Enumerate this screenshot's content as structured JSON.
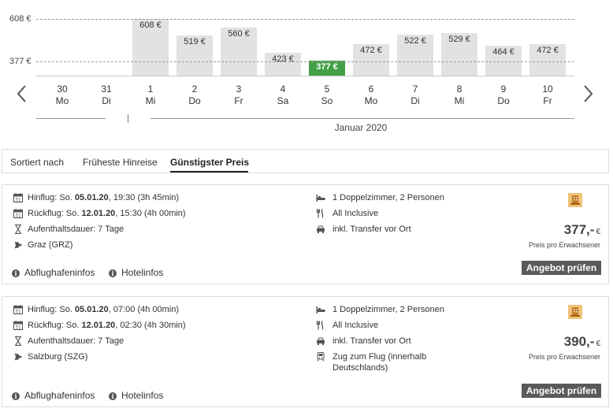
{
  "chart_data": {
    "type": "bar",
    "categories": [
      "1 Mi",
      "2 Do",
      "3 Fr",
      "4 Sa",
      "5 So",
      "6 Mo",
      "7 Di",
      "8 Mi",
      "9 Do",
      "10 Fr"
    ],
    "values": [
      608,
      519,
      560,
      423,
      377,
      472,
      522,
      529,
      464,
      472
    ],
    "labels": [
      "608 €",
      "519 €",
      "560 €",
      "423 €",
      "377 €",
      "472 €",
      "522 €",
      "529 €",
      "464 €",
      "472 €"
    ],
    "highlighted_index": 4,
    "ylim": [
      300,
      608
    ],
    "reference_lines": [
      {
        "value": 608,
        "label": "608 €"
      },
      {
        "value": 377,
        "label": "377 €"
      }
    ],
    "colors": {
      "bar": "#e2e2e2",
      "selected": "#43a047"
    }
  },
  "days": [
    {
      "num": "30",
      "dow": "Mo"
    },
    {
      "num": "31",
      "dow": "Di"
    },
    {
      "num": "1",
      "dow": "Mi"
    },
    {
      "num": "2",
      "dow": "Do"
    },
    {
      "num": "3",
      "dow": "Fr"
    },
    {
      "num": "4",
      "dow": "Sa"
    },
    {
      "num": "5",
      "dow": "So"
    },
    {
      "num": "6",
      "dow": "Mo"
    },
    {
      "num": "7",
      "dow": "Di"
    },
    {
      "num": "8",
      "dow": "Mi"
    },
    {
      "num": "9",
      "dow": "Do"
    },
    {
      "num": "10",
      "dow": "Fr"
    }
  ],
  "month_label": "Januar 2020",
  "nav": {
    "prev_icon": "chevron-left-icon",
    "next_icon": "chevron-right-icon"
  },
  "sort": {
    "label": "Sortiert nach",
    "tabs": [
      "Früheste Hinreise",
      "Günstigster Preis"
    ],
    "active": "Günstigster Preis"
  },
  "offers": [
    {
      "outbound_prefix": "Hinflug: So. ",
      "outbound_date": "05.01.20",
      "outbound_rest": ", 19:30 (3h 45min)",
      "return_prefix": "Rückflug: So. ",
      "return_date": "12.01.20",
      "return_rest": ", 15:30 (4h 00min)",
      "stay": "Aufenthaltsdauer: 7 Tage",
      "airport": "Graz (GRZ)",
      "room": "1 Doppelzimmer, 2 Personen",
      "board": "All Inclusive",
      "transfer": "inkl. Transfer vor Ort",
      "price": "377,-",
      "currency": "€",
      "price_note": "Preis pro Erwachsener",
      "button": "Angebot prüfen",
      "link_airport": "Abflughafeninfos",
      "link_hotel": "Hotelinfos"
    },
    {
      "outbound_prefix": "Hinflug: So. ",
      "outbound_date": "05.01.20",
      "outbound_rest": ", 07:00 (4h 00min)",
      "return_prefix": "Rückflug: So. ",
      "return_date": "12.01.20",
      "return_rest": ", 02:30 (4h 30min)",
      "stay": "Aufenthaltsdauer: 7 Tage",
      "airport": "Salzburg (SZG)",
      "room": "1 Doppelzimmer, 2 Personen",
      "board": "All Inclusive",
      "transfer": "inkl. Transfer vor Ort",
      "train_line1": "Zug zum Flug (innerhalb",
      "train_line2": "Deutschlands)",
      "price": "390,-",
      "currency": "€",
      "price_note": "Preis pro Erwachsener",
      "button": "Angebot prüfen",
      "link_airport": "Abflughafeninfos",
      "link_hotel": "Hotelinfos"
    }
  ]
}
